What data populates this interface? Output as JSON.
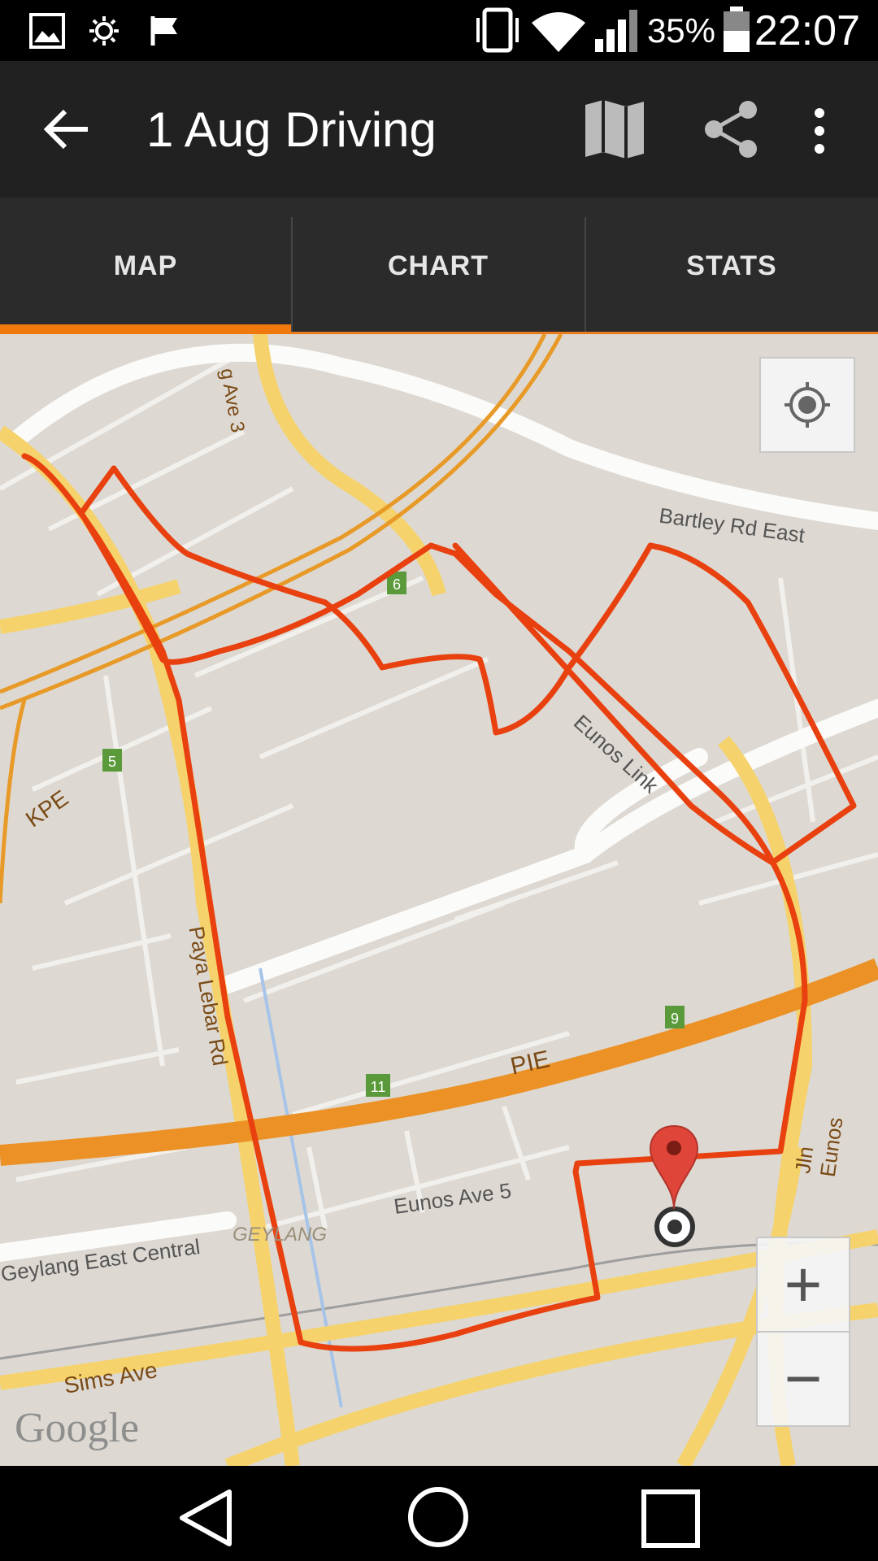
{
  "status_bar": {
    "battery_percent": "35%",
    "time": "22:07",
    "icons": [
      "gallery-icon",
      "brightness-icon",
      "flag-icon",
      "vibrate-icon",
      "wifi-icon",
      "signal-icon",
      "battery-icon"
    ]
  },
  "app_bar": {
    "title": "1 Aug Driving",
    "icons": [
      "back-arrow-icon",
      "map-icon",
      "share-icon",
      "more-vert-icon"
    ]
  },
  "tabs": [
    {
      "label": "MAP",
      "selected": true
    },
    {
      "label": "CHART",
      "selected": false
    },
    {
      "label": "STATS",
      "selected": false
    }
  ],
  "accent_color": "#f0790e",
  "route_color": "#e8400f",
  "map": {
    "labels": {
      "ave3": "g Ave 3",
      "bartley": "Bartley Rd East",
      "kpe": "KPE",
      "eunos_link": "Eunos Link",
      "paya_lebar": "Paya Lebar Rd",
      "pie": "PIE",
      "jln_eunos": "Jln Eunos",
      "eunos_ave5": "Eunos Ave 5",
      "geylang": "GEYLANG",
      "geylang_east": "Geylang East Central",
      "sims_ave": "Sims Ave",
      "google": "Google"
    },
    "exit_markers": [
      "6",
      "5",
      "9",
      "11"
    ],
    "controls": {
      "zoom_in": "+",
      "zoom_out": "−"
    }
  },
  "nav_bar": {
    "icons": [
      "back-triangle-icon",
      "home-circle-icon",
      "recents-square-icon"
    ]
  }
}
